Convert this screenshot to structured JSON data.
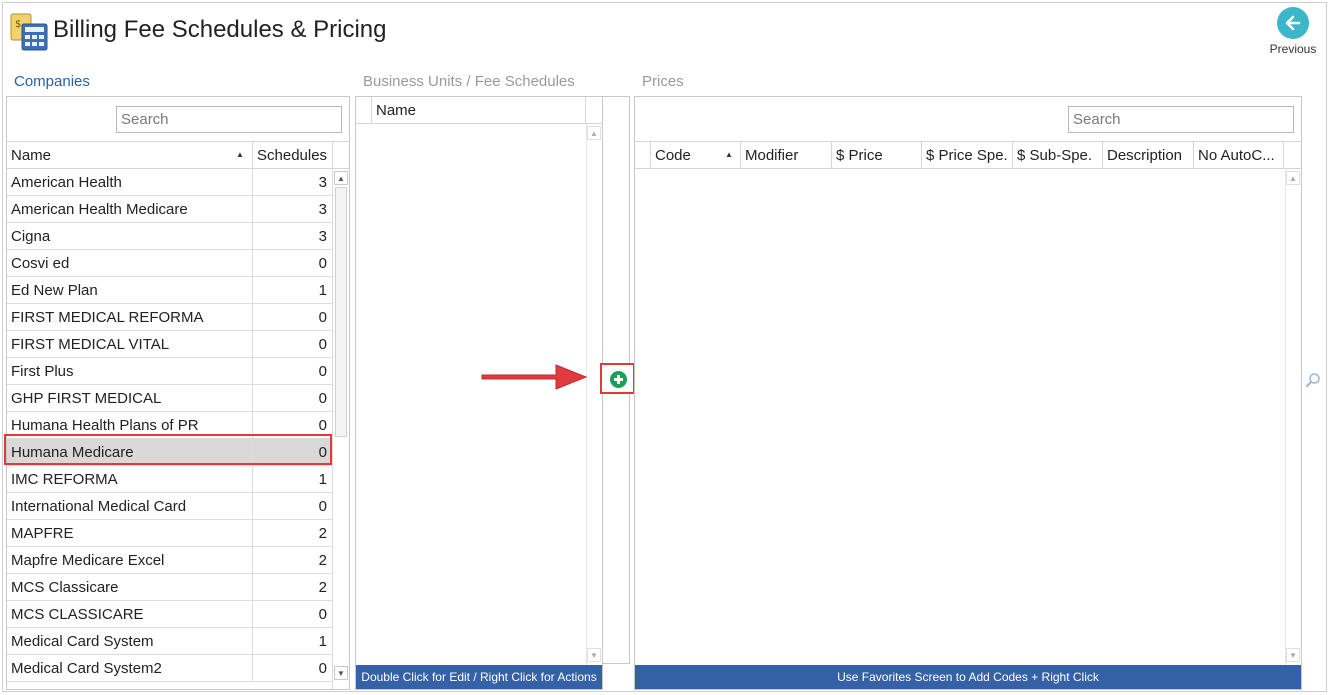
{
  "header": {
    "title": "Billing Fee Schedules & Pricing",
    "previous_label": "Previous"
  },
  "sections": {
    "companies": "Companies",
    "business_units": "Business Units / Fee Schedules",
    "prices": "Prices"
  },
  "companies": {
    "search_placeholder": "Search",
    "columns": [
      "Name",
      "Schedules"
    ],
    "selected_index": 10,
    "rows": [
      {
        "name": "American Health",
        "schedules": "3"
      },
      {
        "name": "American Health Medicare",
        "schedules": "3"
      },
      {
        "name": "Cigna",
        "schedules": "3"
      },
      {
        "name": "Cosvi ed",
        "schedules": "0"
      },
      {
        "name": "Ed New Plan",
        "schedules": "1"
      },
      {
        "name": "FIRST MEDICAL REFORMA",
        "schedules": "0"
      },
      {
        "name": "FIRST MEDICAL VITAL",
        "schedules": "0"
      },
      {
        "name": "First Plus",
        "schedules": "0"
      },
      {
        "name": "GHP FIRST MEDICAL",
        "schedules": "0"
      },
      {
        "name": "Humana Health Plans of PR",
        "schedules": "0"
      },
      {
        "name": "Humana Medicare",
        "schedules": "0"
      },
      {
        "name": "IMC REFORMA",
        "schedules": "1"
      },
      {
        "name": "International Medical Card",
        "schedules": "0"
      },
      {
        "name": "MAPFRE",
        "schedules": "2"
      },
      {
        "name": "Mapfre Medicare Excel",
        "schedules": "2"
      },
      {
        "name": "MCS Classicare",
        "schedules": "2"
      },
      {
        "name": "MCS CLASSICARE",
        "schedules": "0"
      },
      {
        "name": "Medical Card System",
        "schedules": "1"
      },
      {
        "name": "Medical Card System2",
        "schedules": "0"
      }
    ]
  },
  "business_units": {
    "columns": [
      "Name"
    ],
    "footer": "Double Click for Edit / Right Click for Actions"
  },
  "prices": {
    "search_placeholder": "Search",
    "columns": [
      "Code",
      "Modifier",
      "$ Price",
      "$ Price Spe.",
      "$ Sub-Spe.",
      "Description",
      "No AutoC..."
    ],
    "footer": "Use Favorites Screen to Add Codes + Right Click"
  },
  "colors": {
    "accent": "#1e63b0",
    "footer_bar": "#3561a6",
    "highlight": "#e0393e",
    "previous_button": "#3bb7c9",
    "add_button": "#1f9e5a"
  },
  "icons": {
    "title": "calculator-icon",
    "previous": "arrow-left-icon",
    "add": "plus-circle-icon",
    "zoom": "magnifier-icon"
  }
}
